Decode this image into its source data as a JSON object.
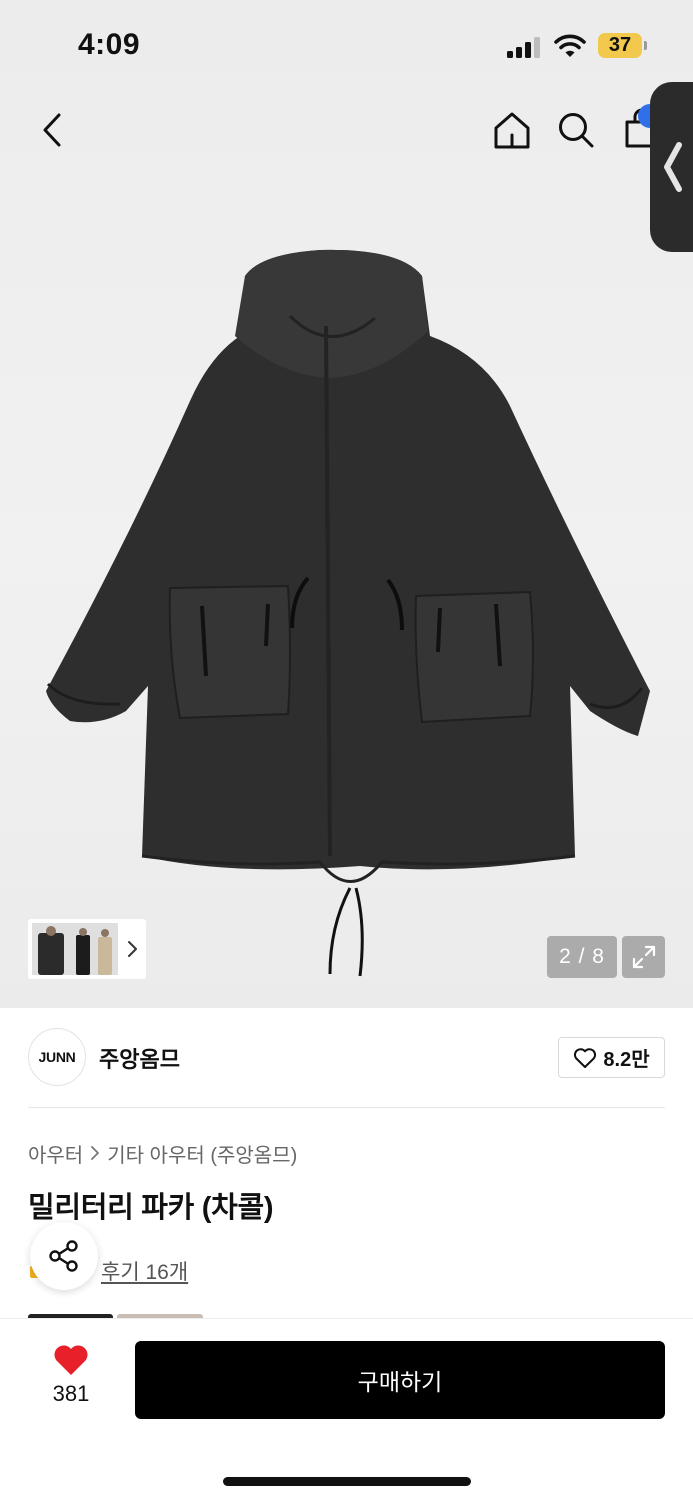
{
  "status_bar": {
    "time": "4:09",
    "battery": "37"
  },
  "colors": {
    "accent_black": "#000000",
    "wish_red": "#e8202a",
    "battery_yellow": "#f2c94c",
    "cart_badge": "#2f6fe9"
  },
  "header": {
    "back_icon": "chevron-left-icon",
    "home_icon": "home-icon",
    "search_icon": "search-icon",
    "cart_icon": "shopping-bag-icon"
  },
  "gallery": {
    "counter": "2 / 8",
    "current": 2,
    "total": 8
  },
  "brand": {
    "logo_text": "JUNN",
    "name": "주앙옴므",
    "likes": "8.2만"
  },
  "breadcrumb": {
    "category": "아우터",
    "subcategory": "기타 아우터 (주앙옴므)"
  },
  "product": {
    "title": "밀리터리 파카 (차콜)",
    "reviews": "후기 16개"
  },
  "bottom_bar": {
    "wish_count": "381",
    "buy_label": "구매하기"
  }
}
